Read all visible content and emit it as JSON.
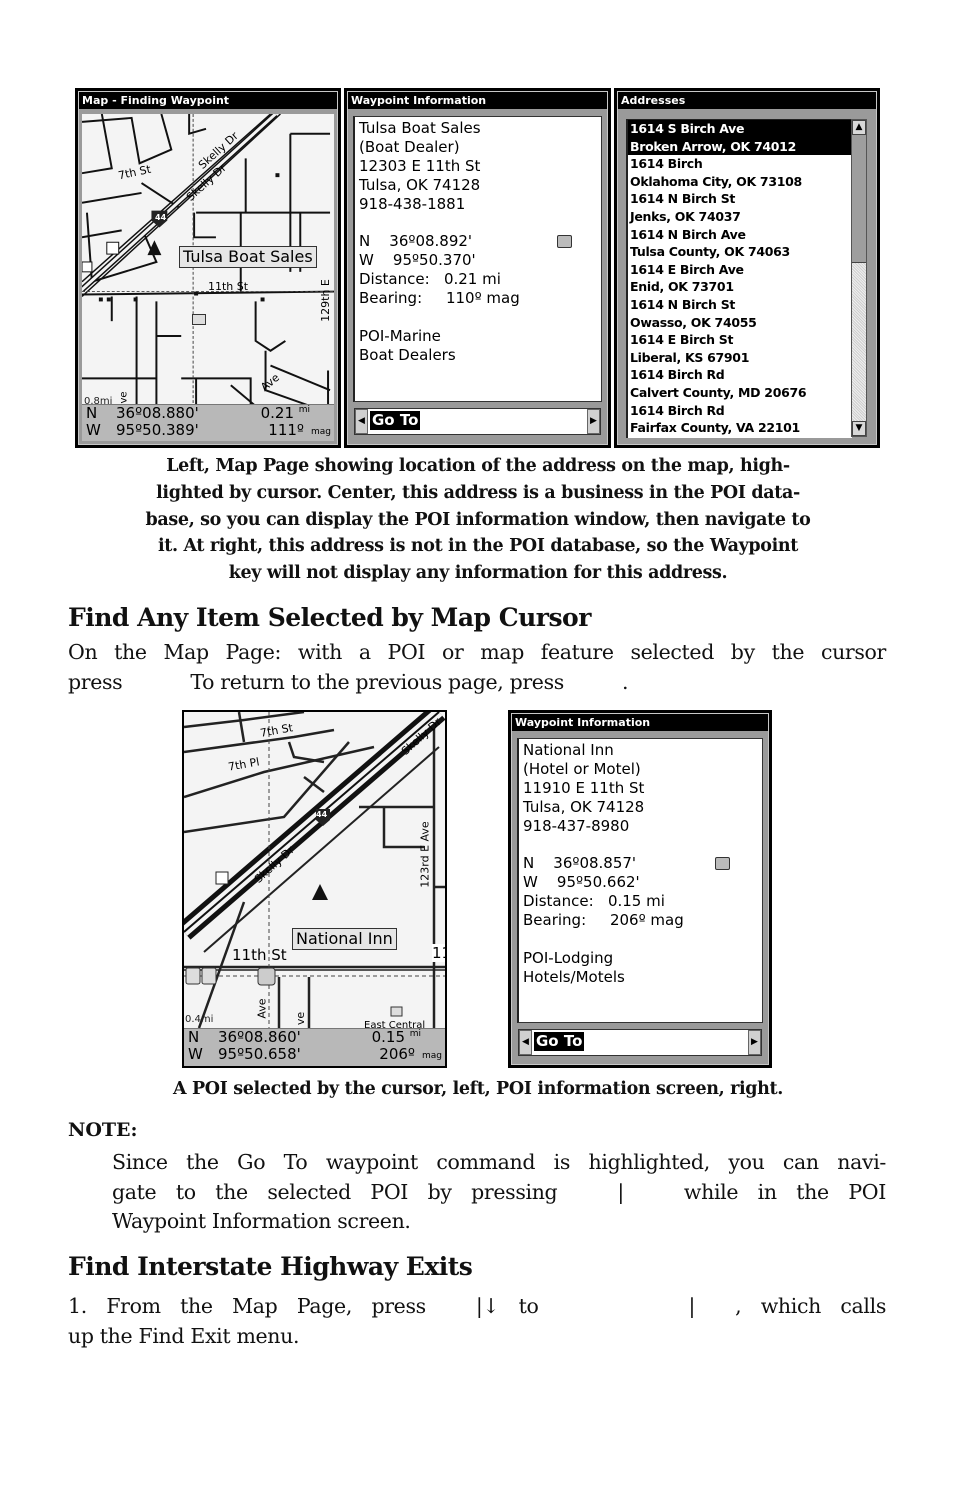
{
  "figure1": {
    "map_screen": {
      "title": "Map - Finding Waypoint",
      "cursor_label": "Tulsa Boat Sales",
      "street_labels": [
        "7th St",
        "Skelly Dr",
        "Skelly Dr",
        "11th St",
        "129th E",
        "Ave",
        "ve"
      ],
      "highway_shield": "44",
      "scale": "0.8mi",
      "status": {
        "lat_dir": "N",
        "lat": "36º08.880'",
        "distance": "0.21",
        "distance_unit": "mi",
        "lon_dir": "W",
        "lon": "95º50.389'",
        "bearing": "111º",
        "bearing_unit": "mag"
      }
    },
    "waypoint_screen": {
      "title": "Waypoint Information",
      "lines": [
        "Tulsa Boat Sales",
        "(Boat Dealer)",
        "12303 E 11th St",
        "Tulsa, OK 74128",
        "918-438-1881",
        "",
        "N    36º08.892'",
        "W    95º50.370'",
        "Distance:   0.21 mi",
        "Bearing:     110º mag",
        "",
        "POI-Marine",
        "Boat Dealers"
      ],
      "poi_icon": "boat-dealer-icon",
      "command": "Go To",
      "left_arrow": "◀",
      "right_arrow": "▶"
    },
    "addresses_screen": {
      "title": "Addresses",
      "items": [
        {
          "line1": "1614 S Birch Ave",
          "line2": "Broken Arrow, OK  74012",
          "selected": true
        },
        {
          "line1": "1614 Birch",
          "line2": "Oklahoma City, OK  73108",
          "selected": false
        },
        {
          "line1": "1614 N Birch St",
          "line2": "Jenks, OK  74037",
          "selected": false
        },
        {
          "line1": "1614 N Birch Ave",
          "line2": "Tulsa County, OK  74063",
          "selected": false
        },
        {
          "line1": "1614 E Birch Ave",
          "line2": "Enid, OK  73701",
          "selected": false
        },
        {
          "line1": "1614 N Birch St",
          "line2": "Owasso, OK  74055",
          "selected": false
        },
        {
          "line1": "1614 E Birch St",
          "line2": "Liberal, KS  67901",
          "selected": false
        },
        {
          "line1": "1614 Birch Rd",
          "line2": "Calvert County, MD  20676",
          "selected": false
        },
        {
          "line1": "1614 Birch Rd",
          "line2": "Fairfax County, VA  22101",
          "selected": false
        }
      ],
      "scroll_up": "▲",
      "scroll_down": "▼"
    },
    "caption_lines": [
      "Left, Map Page showing location of the address on the map, high-",
      "lighted by cursor. Center, this address is a business in the POI data-",
      "base, so you can display the POI information window, then navigate to",
      "it. At right, this address is not in the POI database, so the Waypoint",
      "key will not display any information for this address."
    ]
  },
  "section1": {
    "heading": "Find Any Item Selected by Map Cursor",
    "para_line1": "On the Map Page: with a POI or map feature selected by the cursor",
    "para_line2_a": "press",
    "para_line2_b": "To return to the previous page, press",
    "para_line2_c": "."
  },
  "figure2": {
    "map_screen": {
      "cursor_label": "National Inn",
      "street_labels": [
        "7th St",
        "7th Pl",
        "Skelly Dr",
        "Skelly Dr",
        "123rd E Ave",
        "11th St",
        "11",
        "Ave",
        "ve",
        "East Central"
      ],
      "highway_shield": "44",
      "scale": "0.4mi",
      "status": {
        "lat_dir": "N",
        "lat": "36º08.860'",
        "distance": "0.15",
        "distance_unit": "mi",
        "lon_dir": "W",
        "lon": "95º50.658'",
        "bearing": "206º",
        "bearing_unit": "mag"
      }
    },
    "waypoint_screen": {
      "title": "Waypoint Information",
      "lines": [
        "National Inn",
        "(Hotel or Motel)",
        "11910 E 11th St",
        "Tulsa, OK 74128",
        "918-437-8980",
        "",
        "N    36º08.857'",
        "W    95º50.662'",
        "Distance:   0.15 mi",
        "Bearing:     206º mag",
        "",
        "POI-Lodging",
        "Hotels/Motels"
      ],
      "poi_icon": "hotel-icon",
      "command": "Go To",
      "left_arrow": "◀",
      "right_arrow": "▶"
    },
    "caption": "A POI selected by the cursor, left, POI information screen, right."
  },
  "note": {
    "label": "NOTE:",
    "line1": "Since the Go To waypoint command is highlighted, you can navi-",
    "line2_a": "gate to the selected POI by pressing",
    "line2_sep": "|",
    "line2_b": "while in the POI",
    "line3": "Waypoint Information screen."
  },
  "section2": {
    "heading": "Find Interstate Highway Exits",
    "line1_a": "1. From the Map Page, press",
    "line1_b": "|↓ to",
    "line1_sep": "|",
    "line1_c": ", which calls",
    "line2": "up the Find Exit menu."
  },
  "colors": {
    "screen_frame": "#000000",
    "screen_bezel": "#9a9a9a",
    "map_bg": "#f4f4f4",
    "status_bar": "#b8b8b8",
    "selection": "#000000",
    "text": "#111111"
  }
}
